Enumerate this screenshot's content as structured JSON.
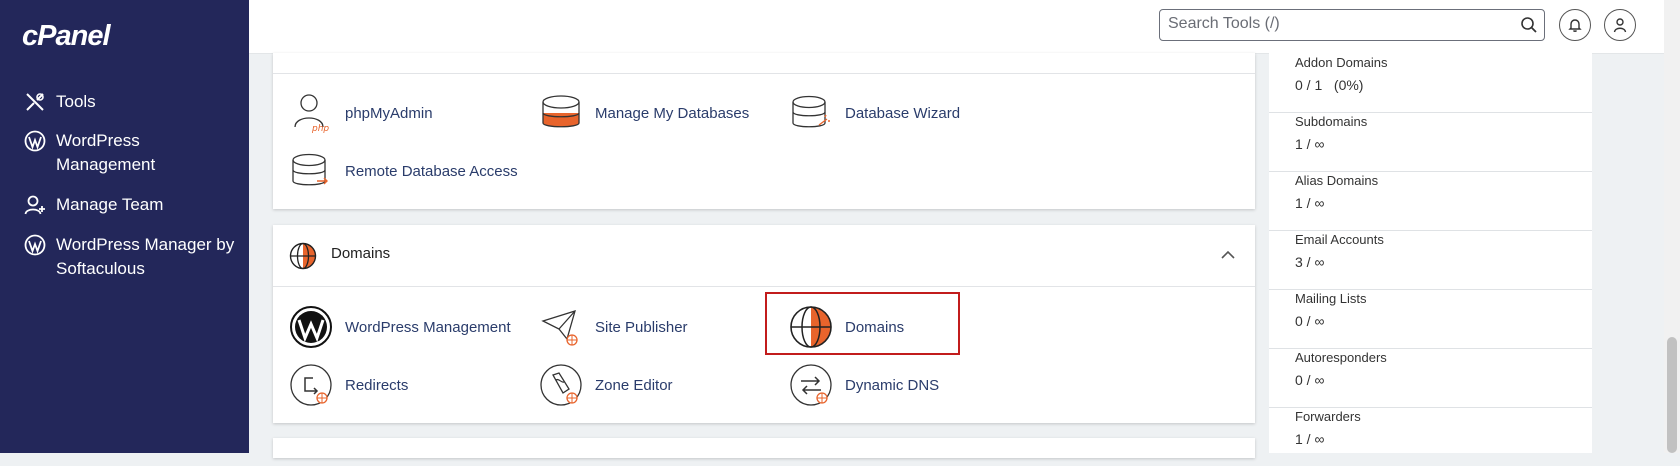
{
  "app": {
    "logo": "cPanel"
  },
  "sidebar": {
    "items": [
      {
        "label": "Tools",
        "icon": "tools-icon"
      },
      {
        "label": "WordPress Management",
        "icon": "wordpress-icon"
      },
      {
        "label": "Manage Team",
        "icon": "manage-team-icon"
      },
      {
        "label": "WordPress Manager by Softaculous",
        "icon": "wordpress-icon"
      }
    ]
  },
  "header": {
    "search_placeholder": "Search Tools (/)",
    "icons": [
      "search-icon",
      "bell-icon",
      "user-icon"
    ]
  },
  "databases": {
    "tools": [
      {
        "label": "phpMyAdmin",
        "icon": "phpmyadmin-icon"
      },
      {
        "label": "Manage My Databases",
        "icon": "database-icon"
      },
      {
        "label": "Database Wizard",
        "icon": "database-wizard-icon"
      },
      {
        "label": "Remote Database Access",
        "icon": "remote-database-icon"
      }
    ]
  },
  "domains": {
    "title": "Domains",
    "tools": [
      {
        "label": "WordPress Management",
        "icon": "wordpress-icon"
      },
      {
        "label": "Site Publisher",
        "icon": "site-publisher-icon"
      },
      {
        "label": "Domains",
        "icon": "globe-icon"
      },
      {
        "label": "Redirects",
        "icon": "redirects-icon"
      },
      {
        "label": "Zone Editor",
        "icon": "zone-editor-icon"
      },
      {
        "label": "Dynamic DNS",
        "icon": "dynamic-dns-icon"
      }
    ]
  },
  "stats": [
    {
      "label": "Addon Domains",
      "value": "0 / 1   (0%)"
    },
    {
      "label": "Subdomains",
      "value": "1 / ∞"
    },
    {
      "label": "Alias Domains",
      "value": "1 / ∞"
    },
    {
      "label": "Email Accounts",
      "value": "3 / ∞"
    },
    {
      "label": "Mailing Lists",
      "value": "0 / ∞"
    },
    {
      "label": "Autoresponders",
      "value": "0 / ∞"
    },
    {
      "label": "Forwarders",
      "value": "1 / ∞"
    }
  ],
  "colors": {
    "sidebar": "#23275a",
    "accent": "#e8642c",
    "link": "#2a3c6b",
    "highlight": "#c21c1c"
  }
}
